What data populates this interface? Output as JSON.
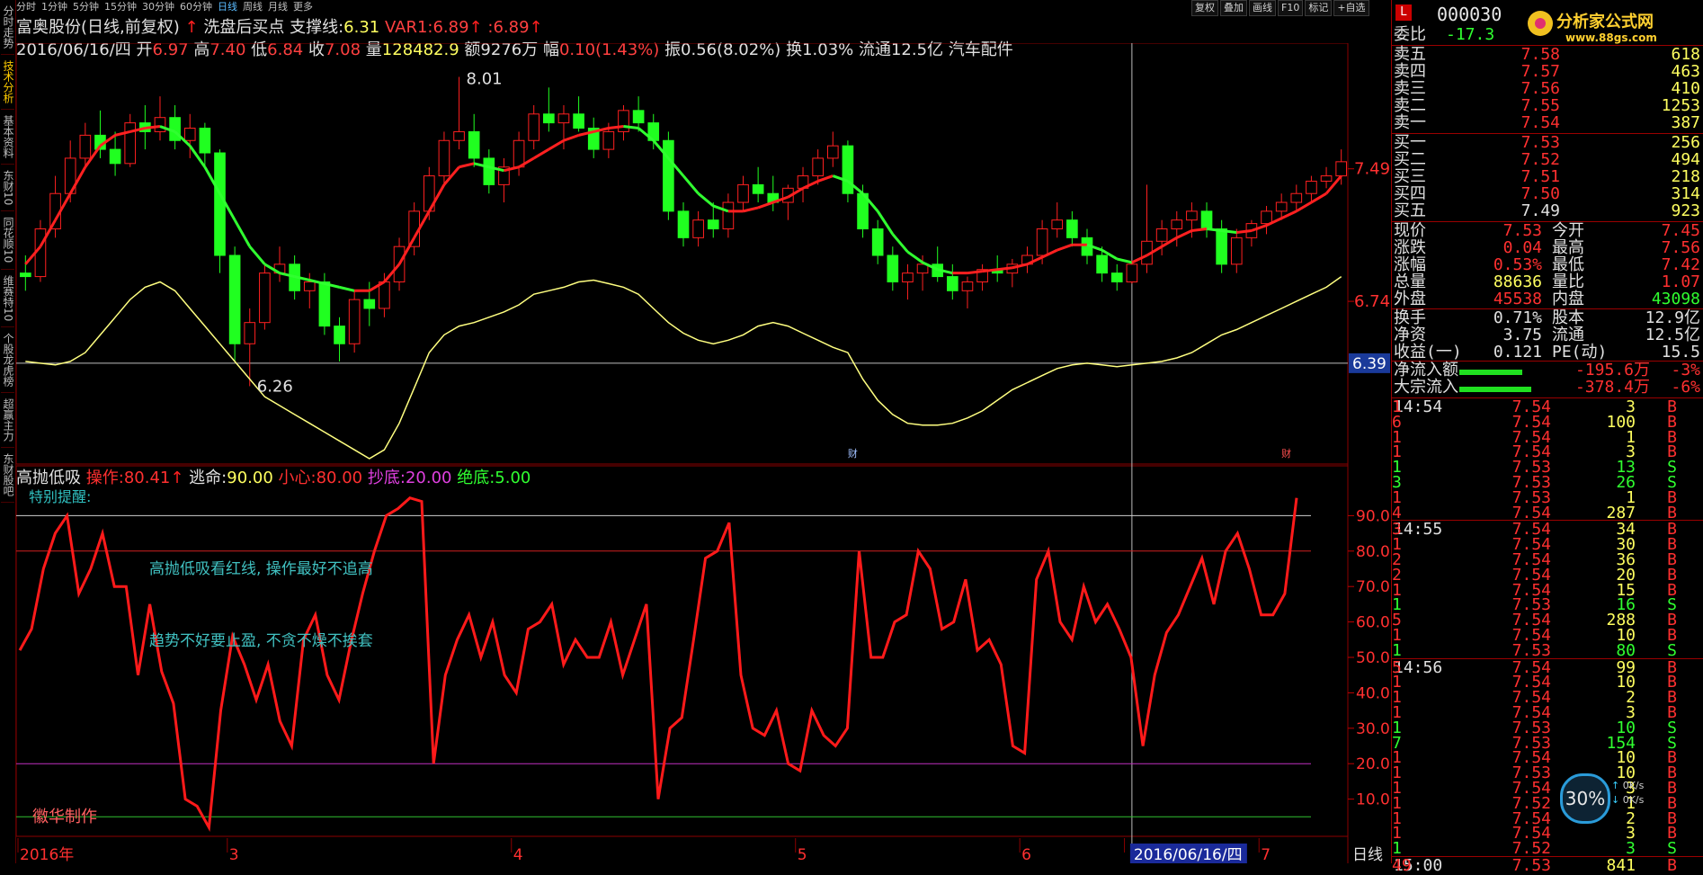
{
  "left_tabs": [
    "分时走势",
    "技术分析",
    "基本资料",
    "东财10",
    "同花顺10",
    "维赛特10",
    "个股龙虎榜",
    "超赢主力",
    "东财股吧"
  ],
  "timeframes": [
    "分时",
    "1分钟",
    "5分钟",
    "15分钟",
    "30分钟",
    "60分钟",
    "日线",
    "周线",
    "月线",
    "更多"
  ],
  "active_timeframe": "日线",
  "toolbar": [
    "复权",
    "叠加",
    "画线",
    "F10",
    "标记",
    "+自选"
  ],
  "header": {
    "name": "富奥股份(日线,前复权)",
    "signal": "洗盘后买点",
    "support_label": "支撑线:",
    "support_val": "6.31",
    "var1_label": "VAR1:",
    "var1_val": "6.89",
    "extra_val": ":6.89",
    "date": "2016/06/16/四",
    "open_l": "开",
    "open": "6.97",
    "high_l": "高",
    "high": "7.40",
    "low_l": "低",
    "low": "6.84",
    "close_l": "收",
    "close": "7.08",
    "vol_l": "量",
    "vol": "128482.9",
    "amt_l": "额",
    "amt": "9276万",
    "chg_l": "幅",
    "chg": "0.10(1.43%)",
    "amp_l": "振",
    "amp": "0.56(8.02%)",
    "turn_l": "换",
    "turn": "1.03%",
    "float_l": "流通",
    "float": "12.5亿",
    "sector": "汽车配件"
  },
  "indicator": {
    "name": "高抛低吸",
    "op_l": "操作:",
    "op": "80.41",
    "esc_l": "逃命:",
    "esc": "90.00",
    "care_l": "小心:",
    "care": "80.00",
    "bot_l": "抄底:",
    "bot": "20.00",
    "abs_l": "绝底:",
    "abs": "5.00",
    "note": "特别提醒:",
    "text1": "高抛低吸看红线, 操作最好不追高",
    "text2": "趋势不好要止盈, 不贪不燥不挨套",
    "author": "徽华制作"
  },
  "chart_data": {
    "type": "candlestick",
    "price_axis_ticks": [
      "7.49",
      "6.74"
    ],
    "cursor_price": "6.39",
    "price_annotations": [
      "8.01",
      "6.26"
    ],
    "event_marks": [
      "财",
      "财"
    ],
    "x_labels": [
      "2016年",
      "3",
      "4",
      "5",
      "6",
      "2016/06/16/四",
      "7"
    ],
    "x_tail_label": "日线",
    "indicator_ticks": [
      "90.00",
      "80.00",
      "70.00",
      "60.00",
      "50.00",
      "40.00",
      "30.00",
      "20.00",
      "10.00"
    ],
    "ohlc": [
      [
        6.9,
        7.0,
        6.8,
        6.88
      ],
      [
        6.88,
        7.2,
        6.85,
        7.15
      ],
      [
        7.15,
        7.45,
        7.1,
        7.35
      ],
      [
        7.35,
        7.65,
        7.3,
        7.55
      ],
      [
        7.55,
        7.75,
        7.5,
        7.68
      ],
      [
        7.68,
        7.82,
        7.55,
        7.6
      ],
      [
        7.6,
        7.7,
        7.45,
        7.52
      ],
      [
        7.52,
        7.8,
        7.5,
        7.75
      ],
      [
        7.75,
        7.85,
        7.6,
        7.7
      ],
      [
        7.7,
        7.9,
        7.65,
        7.78
      ],
      [
        7.78,
        7.85,
        7.6,
        7.65
      ],
      [
        7.65,
        7.8,
        7.55,
        7.72
      ],
      [
        7.72,
        7.75,
        7.5,
        7.58
      ],
      [
        7.58,
        7.6,
        6.9,
        7.0
      ],
      [
        7.0,
        7.05,
        6.4,
        6.5
      ],
      [
        6.5,
        6.7,
        6.26,
        6.62
      ],
      [
        6.62,
        6.95,
        6.58,
        6.9
      ],
      [
        6.9,
        7.05,
        6.85,
        6.95
      ],
      [
        6.95,
        7.0,
        6.75,
        6.8
      ],
      [
        6.8,
        6.9,
        6.7,
        6.85
      ],
      [
        6.85,
        6.9,
        6.55,
        6.6
      ],
      [
        6.6,
        6.65,
        6.4,
        6.5
      ],
      [
        6.5,
        6.8,
        6.45,
        6.75
      ],
      [
        6.75,
        6.85,
        6.6,
        6.7
      ],
      [
        6.7,
        6.9,
        6.65,
        6.85
      ],
      [
        6.85,
        7.1,
        6.8,
        7.05
      ],
      [
        7.05,
        7.3,
        7.0,
        7.25
      ],
      [
        7.25,
        7.5,
        7.2,
        7.45
      ],
      [
        7.45,
        7.7,
        7.4,
        7.65
      ],
      [
        7.65,
        8.01,
        7.6,
        7.7
      ],
      [
        7.7,
        7.8,
        7.5,
        7.55
      ],
      [
        7.55,
        7.6,
        7.35,
        7.4
      ],
      [
        7.4,
        7.55,
        7.3,
        7.5
      ],
      [
        7.5,
        7.7,
        7.45,
        7.65
      ],
      [
        7.65,
        7.85,
        7.6,
        7.8
      ],
      [
        7.8,
        7.95,
        7.7,
        7.75
      ],
      [
        7.75,
        7.85,
        7.6,
        7.8
      ],
      [
        7.8,
        7.9,
        7.7,
        7.72
      ],
      [
        7.72,
        7.78,
        7.55,
        7.6
      ],
      [
        7.6,
        7.75,
        7.55,
        7.7
      ],
      [
        7.7,
        7.85,
        7.65,
        7.82
      ],
      [
        7.82,
        7.9,
        7.7,
        7.75
      ],
      [
        7.75,
        7.8,
        7.6,
        7.65
      ],
      [
        7.65,
        7.7,
        7.2,
        7.25
      ],
      [
        7.25,
        7.3,
        7.05,
        7.1
      ],
      [
        7.1,
        7.25,
        7.05,
        7.2
      ],
      [
        7.2,
        7.3,
        7.1,
        7.15
      ],
      [
        7.15,
        7.35,
        7.1,
        7.3
      ],
      [
        7.3,
        7.45,
        7.25,
        7.4
      ],
      [
        7.4,
        7.5,
        7.3,
        7.35
      ],
      [
        7.35,
        7.45,
        7.25,
        7.3
      ],
      [
        7.3,
        7.4,
        7.2,
        7.38
      ],
      [
        7.38,
        7.5,
        7.3,
        7.45
      ],
      [
        7.45,
        7.6,
        7.4,
        7.55
      ],
      [
        7.55,
        7.7,
        7.5,
        7.62
      ],
      [
        7.62,
        7.65,
        7.3,
        7.35
      ],
      [
        7.35,
        7.4,
        7.1,
        7.15
      ],
      [
        7.15,
        7.2,
        6.95,
        7.0
      ],
      [
        7.0,
        7.05,
        6.8,
        6.85
      ],
      [
        6.85,
        6.95,
        6.75,
        6.9
      ],
      [
        6.9,
        7.0,
        6.8,
        6.95
      ],
      [
        6.95,
        7.05,
        6.85,
        6.88
      ],
      [
        6.88,
        6.95,
        6.75,
        6.8
      ],
      [
        6.8,
        6.88,
        6.7,
        6.85
      ],
      [
        6.85,
        6.95,
        6.8,
        6.92
      ],
      [
        6.92,
        7.0,
        6.85,
        6.9
      ],
      [
        6.9,
        6.98,
        6.82,
        6.95
      ],
      [
        6.95,
        7.05,
        6.9,
        7.0
      ],
      [
        7.0,
        7.2,
        6.95,
        7.15
      ],
      [
        7.15,
        7.3,
        7.1,
        7.2
      ],
      [
        7.2,
        7.25,
        7.05,
        7.1
      ],
      [
        7.1,
        7.15,
        6.95,
        7.0
      ],
      [
        7.0,
        7.05,
        6.85,
        6.9
      ],
      [
        6.9,
        6.95,
        6.8,
        6.85
      ],
      [
        6.85,
        6.97,
        6.84,
        6.95
      ],
      [
        6.95,
        7.4,
        6.9,
        7.08
      ],
      [
        7.08,
        7.2,
        7.0,
        7.15
      ],
      [
        7.15,
        7.25,
        7.05,
        7.2
      ],
      [
        7.2,
        7.3,
        7.1,
        7.25
      ],
      [
        7.25,
        7.3,
        7.1,
        7.15
      ],
      [
        7.15,
        7.2,
        6.9,
        6.95
      ],
      [
        6.95,
        7.15,
        6.9,
        7.1
      ],
      [
        7.1,
        7.2,
        7.05,
        7.18
      ],
      [
        7.18,
        7.28,
        7.12,
        7.25
      ],
      [
        7.25,
        7.35,
        7.2,
        7.3
      ],
      [
        7.3,
        7.4,
        7.25,
        7.35
      ],
      [
        7.35,
        7.45,
        7.3,
        7.42
      ],
      [
        7.42,
        7.5,
        7.38,
        7.45
      ],
      [
        7.45,
        7.6,
        7.4,
        7.53
      ]
    ],
    "ma_upper": [
      6.95,
      7.05,
      7.2,
      7.35,
      7.5,
      7.62,
      7.68,
      7.7,
      7.72,
      7.73,
      7.7,
      7.62,
      7.5,
      7.35,
      7.2,
      7.05,
      6.95,
      6.9,
      6.88,
      6.86,
      6.84,
      6.82,
      6.8,
      6.8,
      6.85,
      6.95,
      7.1,
      7.25,
      7.4,
      7.5,
      7.52,
      7.5,
      7.48,
      7.5,
      7.55,
      7.6,
      7.65,
      7.68,
      7.7,
      7.72,
      7.73,
      7.72,
      7.65,
      7.55,
      7.45,
      7.35,
      7.28,
      7.25,
      7.25,
      7.27,
      7.3,
      7.33,
      7.38,
      7.42,
      7.45,
      7.42,
      7.35,
      7.25,
      7.12,
      7.02,
      6.96,
      6.92,
      6.9,
      6.9,
      6.91,
      6.92,
      6.93,
      6.95,
      6.99,
      7.03,
      7.06,
      7.06,
      7.03,
      6.98,
      6.96,
      7.0,
      7.05,
      7.1,
      7.14,
      7.15,
      7.14,
      7.13,
      7.14,
      7.17,
      7.21,
      7.25,
      7.3,
      7.35,
      7.45
    ],
    "ma_lower": [
      6.4,
      6.39,
      6.38,
      6.4,
      6.45,
      6.55,
      6.65,
      6.75,
      6.82,
      6.85,
      6.8,
      6.7,
      6.6,
      6.5,
      6.4,
      6.3,
      6.2,
      6.15,
      6.1,
      6.05,
      6.0,
      5.95,
      5.9,
      5.85,
      5.9,
      6.05,
      6.25,
      6.45,
      6.55,
      6.6,
      6.62,
      6.65,
      6.68,
      6.72,
      6.78,
      6.8,
      6.82,
      6.85,
      6.86,
      6.84,
      6.82,
      6.78,
      6.7,
      6.62,
      6.56,
      6.52,
      6.5,
      6.52,
      6.55,
      6.6,
      6.62,
      6.6,
      6.56,
      6.52,
      6.48,
      6.45,
      6.3,
      6.18,
      6.1,
      6.05,
      6.04,
      6.04,
      6.05,
      6.08,
      6.12,
      6.18,
      6.24,
      6.28,
      6.32,
      6.36,
      6.38,
      6.39,
      6.38,
      6.37,
      6.38,
      6.39,
      6.4,
      6.42,
      6.45,
      6.5,
      6.55,
      6.58,
      6.62,
      6.66,
      6.7,
      6.74,
      6.78,
      6.82,
      6.88
    ],
    "indicator_line": [
      52,
      58,
      75,
      85,
      90,
      68,
      75,
      85,
      70,
      70,
      45,
      65,
      46,
      37,
      10,
      8,
      2,
      35,
      56,
      48,
      38,
      48,
      32,
      25,
      55,
      62,
      45,
      38,
      54,
      68,
      80,
      90,
      92,
      95,
      94,
      20,
      45,
      55,
      62,
      50,
      60,
      45,
      40,
      58,
      60,
      65,
      48,
      55,
      50,
      50,
      60,
      45,
      55,
      65,
      10,
      30,
      33,
      55,
      78,
      80,
      88,
      45,
      30,
      28,
      35,
      20,
      18,
      35,
      28,
      25,
      30,
      80,
      50,
      50,
      60,
      62,
      80,
      75,
      58,
      60,
      72,
      52,
      55,
      48,
      25,
      23,
      72,
      80,
      60,
      55,
      70,
      60,
      65,
      58,
      50,
      25,
      45,
      57,
      62,
      70,
      78,
      65,
      80,
      85,
      75,
      62,
      62,
      68,
      95
    ]
  },
  "quote": {
    "code": "000030",
    "flag": "L",
    "logo_text": "分析家公式网",
    "logo_url": "www.88gs.com",
    "weibi_l": "委比",
    "weibi": "-17.3",
    "asks": [
      [
        "卖五",
        "7.58",
        "618"
      ],
      [
        "卖四",
        "7.57",
        "463"
      ],
      [
        "卖三",
        "7.56",
        "410"
      ],
      [
        "卖二",
        "7.55",
        "1253"
      ],
      [
        "卖一",
        "7.54",
        "387"
      ]
    ],
    "bids": [
      [
        "买一",
        "7.53",
        "256"
      ],
      [
        "买二",
        "7.52",
        "494"
      ],
      [
        "买三",
        "7.51",
        "218"
      ],
      [
        "买四",
        "7.50",
        "314"
      ],
      [
        "买五",
        "7.49",
        "923"
      ]
    ],
    "stats": [
      [
        "现价",
        "7.53",
        "今开",
        "7.45"
      ],
      [
        "涨跌",
        "0.04",
        "最高",
        "7.56"
      ],
      [
        "涨幅",
        "0.53%",
        "最低",
        "7.42"
      ],
      [
        "总量",
        "88636",
        "量比",
        "1.07"
      ],
      [
        "外盘",
        "45538",
        "内盘",
        "43098"
      ]
    ],
    "stats2": [
      [
        "换手",
        "0.71%",
        "股本",
        "12.9亿"
      ],
      [
        "净资",
        "3.75",
        "流通",
        "12.5亿"
      ],
      [
        "收益(一)",
        "0.121",
        "PE(动)",
        "15.5"
      ]
    ],
    "flows": [
      [
        "净流入额",
        "-195.6万",
        "-3%"
      ],
      [
        "大宗流入",
        "-378.4万",
        "-6%"
      ]
    ],
    "ticks": [
      [
        "14:54",
        "7.54",
        "3",
        "B",
        "1"
      ],
      [
        "",
        "7.54",
        "100",
        "B",
        "6"
      ],
      [
        "",
        "7.54",
        "1",
        "B",
        "1"
      ],
      [
        "",
        "7.54",
        "3",
        "B",
        "1"
      ],
      [
        "",
        "7.53",
        "13",
        "S",
        "1"
      ],
      [
        "",
        "7.53",
        "26",
        "S",
        "3"
      ],
      [
        "",
        "7.53",
        "1",
        "B",
        "1"
      ],
      [
        "",
        "7.54",
        "287",
        "B",
        "4"
      ],
      [
        "14:55",
        "7.54",
        "34",
        "B",
        "3"
      ],
      [
        "",
        "7.54",
        "30",
        "B",
        "1"
      ],
      [
        "",
        "7.54",
        "36",
        "B",
        "2"
      ],
      [
        "",
        "7.54",
        "20",
        "B",
        "2"
      ],
      [
        "",
        "7.54",
        "15",
        "B",
        "1"
      ],
      [
        "",
        "7.53",
        "16",
        "S",
        "1"
      ],
      [
        "",
        "7.54",
        "288",
        "B",
        "5"
      ],
      [
        "",
        "7.54",
        "10",
        "B",
        "1"
      ],
      [
        "",
        "7.53",
        "80",
        "S",
        "1"
      ],
      [
        "14:56",
        "7.54",
        "99",
        "B",
        "5"
      ],
      [
        "",
        "7.54",
        "10",
        "B",
        "1"
      ],
      [
        "",
        "7.54",
        "2",
        "B",
        "1"
      ],
      [
        "",
        "7.54",
        "3",
        "B",
        "1"
      ],
      [
        "",
        "7.53",
        "10",
        "S",
        "1"
      ],
      [
        "",
        "7.53",
        "154",
        "S",
        "7"
      ],
      [
        "",
        "7.54",
        "10",
        "B",
        "1"
      ],
      [
        "",
        "7.53",
        "10",
        "B",
        "1"
      ],
      [
        "",
        "7.54",
        "3",
        "B",
        "1"
      ],
      [
        "",
        "7.52",
        "1",
        "B",
        "1"
      ],
      [
        "",
        "7.54",
        "2",
        "B",
        "1"
      ],
      [
        "",
        "7.54",
        "3",
        "B",
        "1"
      ],
      [
        "",
        "7.52",
        "3",
        "S",
        "1"
      ],
      [
        "15:00",
        "7.53",
        "841",
        "B",
        "49"
      ]
    ],
    "badge": "30%",
    "net_up": "0K/s",
    "net_down": "0K/s"
  }
}
